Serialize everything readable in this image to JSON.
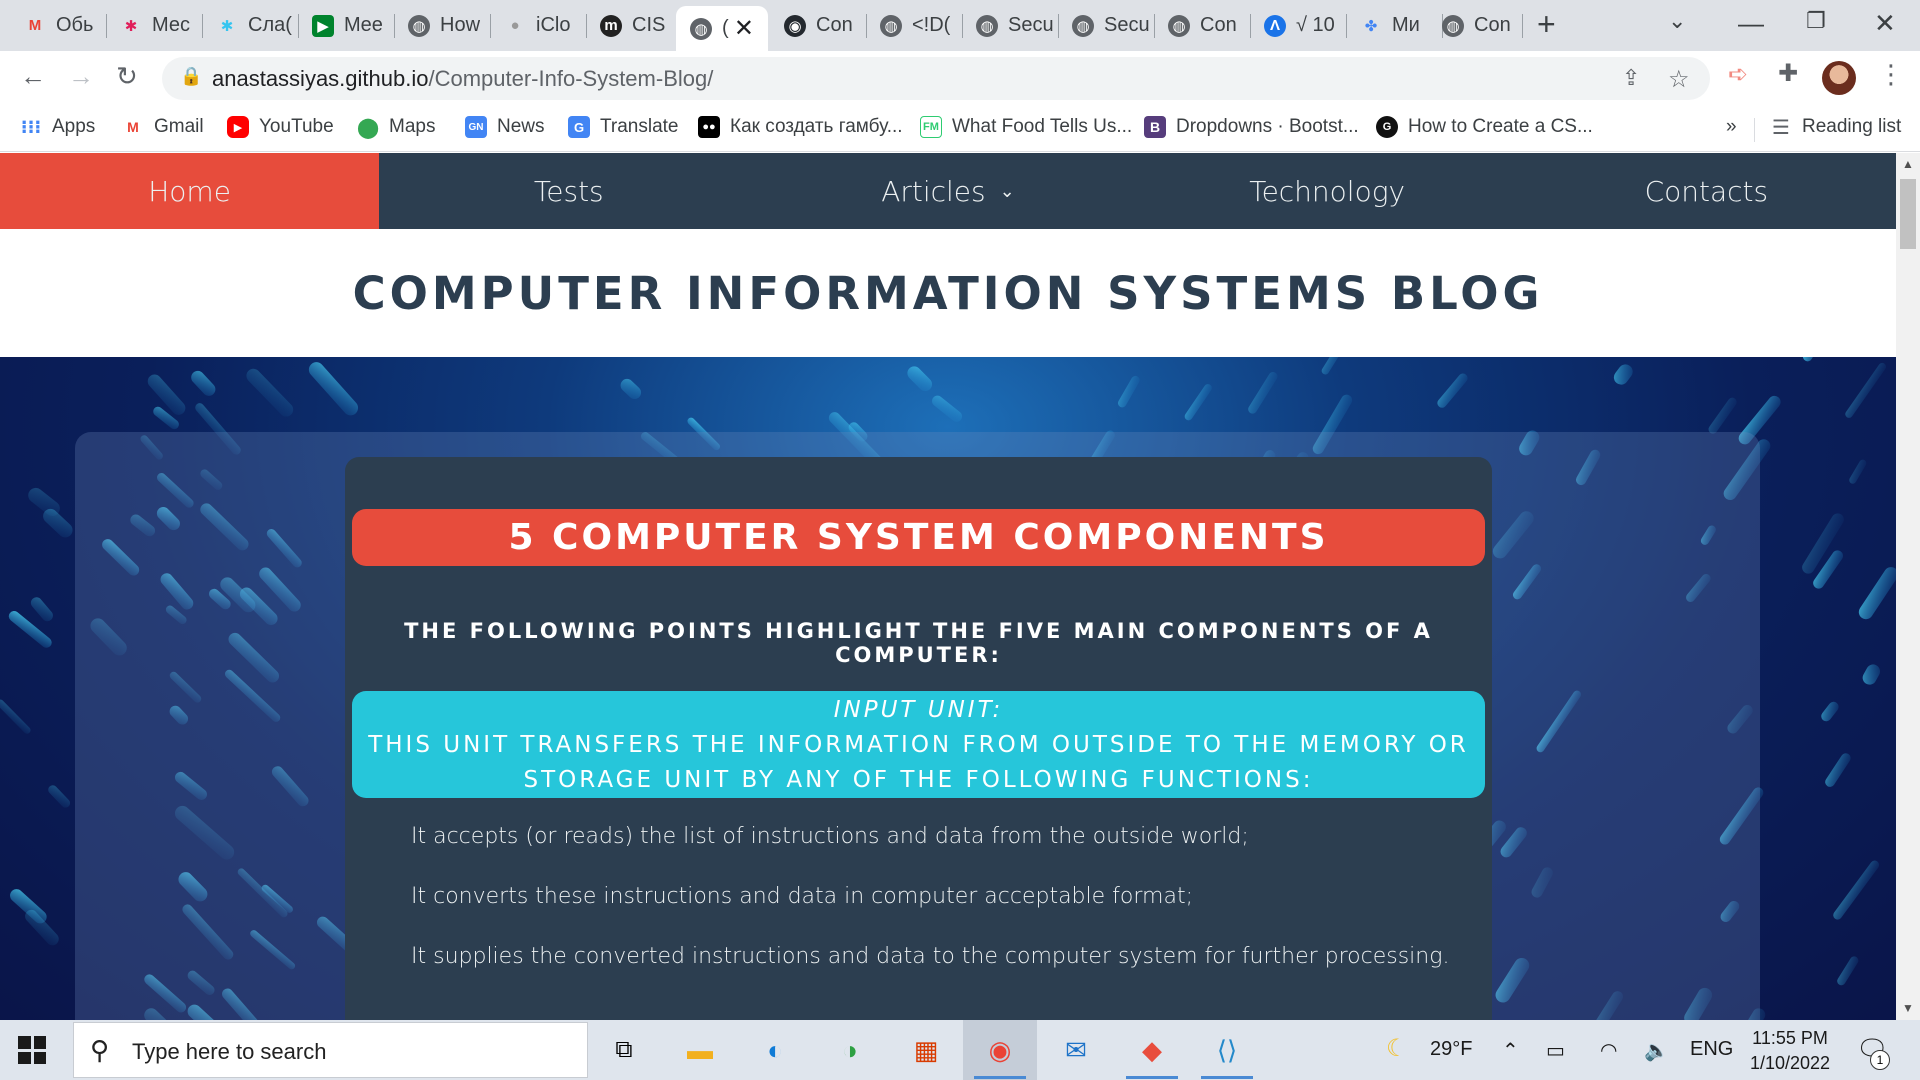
{
  "browser": {
    "tabs": [
      {
        "title": "Обь",
        "icon": "gmail-icon"
      },
      {
        "title": "Мес",
        "icon": "slack-icon"
      },
      {
        "title": "Сла(",
        "icon": "slack-icon"
      },
      {
        "title": "Mee",
        "icon": "google-meet-icon"
      },
      {
        "title": "How",
        "icon": "globe-icon"
      },
      {
        "title": "iClo",
        "icon": "apple-icon"
      },
      {
        "title": "CIS",
        "icon": "medium-icon"
      },
      {
        "title": "(",
        "icon": "globe-icon",
        "active": true
      },
      {
        "title": "Con",
        "icon": "github-icon"
      },
      {
        "title": "<!D(",
        "icon": "globe-icon"
      },
      {
        "title": "Secu",
        "icon": "globe-icon"
      },
      {
        "title": "Secu",
        "icon": "globe-icon"
      },
      {
        "title": "Con",
        "icon": "globe-icon"
      },
      {
        "title": "√ 10",
        "icon": "globe-icon"
      },
      {
        "title": "Ми",
        "icon": "globe-icon"
      },
      {
        "title": "Con",
        "icon": "globe-icon"
      }
    ],
    "url_host": "anastassiyas.github.io",
    "url_path": "/Computer-Info-System-Blog/",
    "bookmarks": [
      {
        "label": "Apps",
        "icon": "apps-grid-icon"
      },
      {
        "label": "Gmail",
        "icon": "gmail-icon"
      },
      {
        "label": "YouTube",
        "icon": "youtube-icon"
      },
      {
        "label": "Maps",
        "icon": "maps-pin-icon"
      },
      {
        "label": "News",
        "icon": "google-news-icon"
      },
      {
        "label": "Translate",
        "icon": "google-translate-icon"
      },
      {
        "label": "Как создать гамбу...",
        "icon": "medium-icon"
      },
      {
        "label": "What Food Tells Us...",
        "icon": "fm-icon"
      },
      {
        "label": "Dropdowns · Bootst...",
        "icon": "bootstrap-icon"
      },
      {
        "label": "How to Create a CS...",
        "icon": "w3-icon"
      }
    ],
    "more_bookmarks": "»",
    "reading_list": "Reading list"
  },
  "site": {
    "nav": [
      {
        "label": "Home",
        "active": true
      },
      {
        "label": "Tests"
      },
      {
        "label": "Articles",
        "dropdown": true
      },
      {
        "label": "Technology"
      },
      {
        "label": "Contacts"
      }
    ],
    "blog_title": "COMPUTER INFORMATION SYSTEMS BLOG",
    "section_title": "5 COMPUTER SYSTEM COMPONENTS",
    "intro": "THE FOLLOWING POINTS HIGHLIGHT THE FIVE MAIN COMPONENTS OF A COMPUTER:",
    "unit": {
      "name": "INPUT UNIT:",
      "description_line1": "THIS UNIT TRANSFERS THE INFORMATION FROM OUTSIDE TO THE MEMORY OR",
      "description_line2": "STORAGE UNIT BY ANY OF THE FOLLOWING FUNCTIONS:"
    },
    "functions": [
      "It accepts (or reads) the list of instructions and data from the outside world;",
      "It converts these instructions and data in computer acceptable format;",
      "It supplies the converted instructions and data to the computer system for further processing."
    ],
    "colors": {
      "nav_bg": "#2c3e50",
      "accent_red": "#e74c3c",
      "accent_cyan": "#26c6da"
    }
  },
  "taskbar": {
    "search_placeholder": "Type here to search",
    "weather": "29°F",
    "language": "ENG",
    "time": "11:55 PM",
    "date": "1/10/2022",
    "notification_count": "1"
  }
}
